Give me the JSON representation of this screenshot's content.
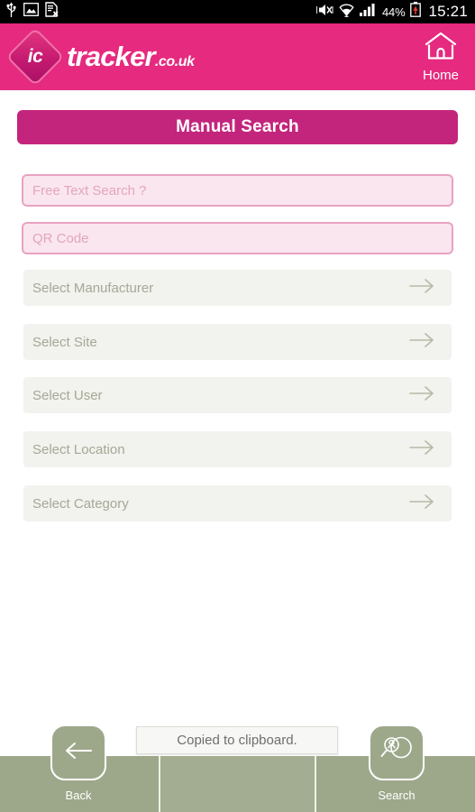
{
  "status_bar": {
    "icons_left": [
      "usb-icon",
      "screenshot-image-icon",
      "sim-card-error-icon"
    ],
    "icons_right": [
      "mute-vibrate-icon",
      "wifi-icon",
      "signal-bars-icon",
      "battery-alert-icon"
    ],
    "battery_percent": "44%",
    "clock": "15:21"
  },
  "header": {
    "logo_badge": "ic",
    "logo_word": "tracker",
    "logo_tld": ".co.uk",
    "home_label": "Home",
    "brand_pink": "#e52a7f"
  },
  "page_title": {
    "label": "Manual Search",
    "color": "#c4257c"
  },
  "text_fields": [
    {
      "name": "free-text-search",
      "placeholder": "Free Text Search ?",
      "value": ""
    },
    {
      "name": "qr-code",
      "placeholder": "QR Code",
      "value": ""
    }
  ],
  "select_rows": [
    {
      "name": "select-manufacturer",
      "label": "Select Manufacturer",
      "icon": "arrow-right-icon"
    },
    {
      "name": "select-site",
      "label": "Select Site",
      "icon": "arrow-right-icon"
    },
    {
      "name": "select-user",
      "label": "Select User",
      "icon": "arrow-right-icon"
    },
    {
      "name": "select-location",
      "label": "Select Location",
      "icon": "arrow-right-icon"
    },
    {
      "name": "select-category",
      "label": "Select Category",
      "icon": "arrow-right-icon"
    }
  ],
  "toast": {
    "message": "Copied to clipboard."
  },
  "bottom_bar": {
    "background": "#9da88b",
    "back_label": "Back",
    "back_icon": "arrow-left-icon",
    "search_label": "Search",
    "search_icon": "search-person-icon"
  }
}
